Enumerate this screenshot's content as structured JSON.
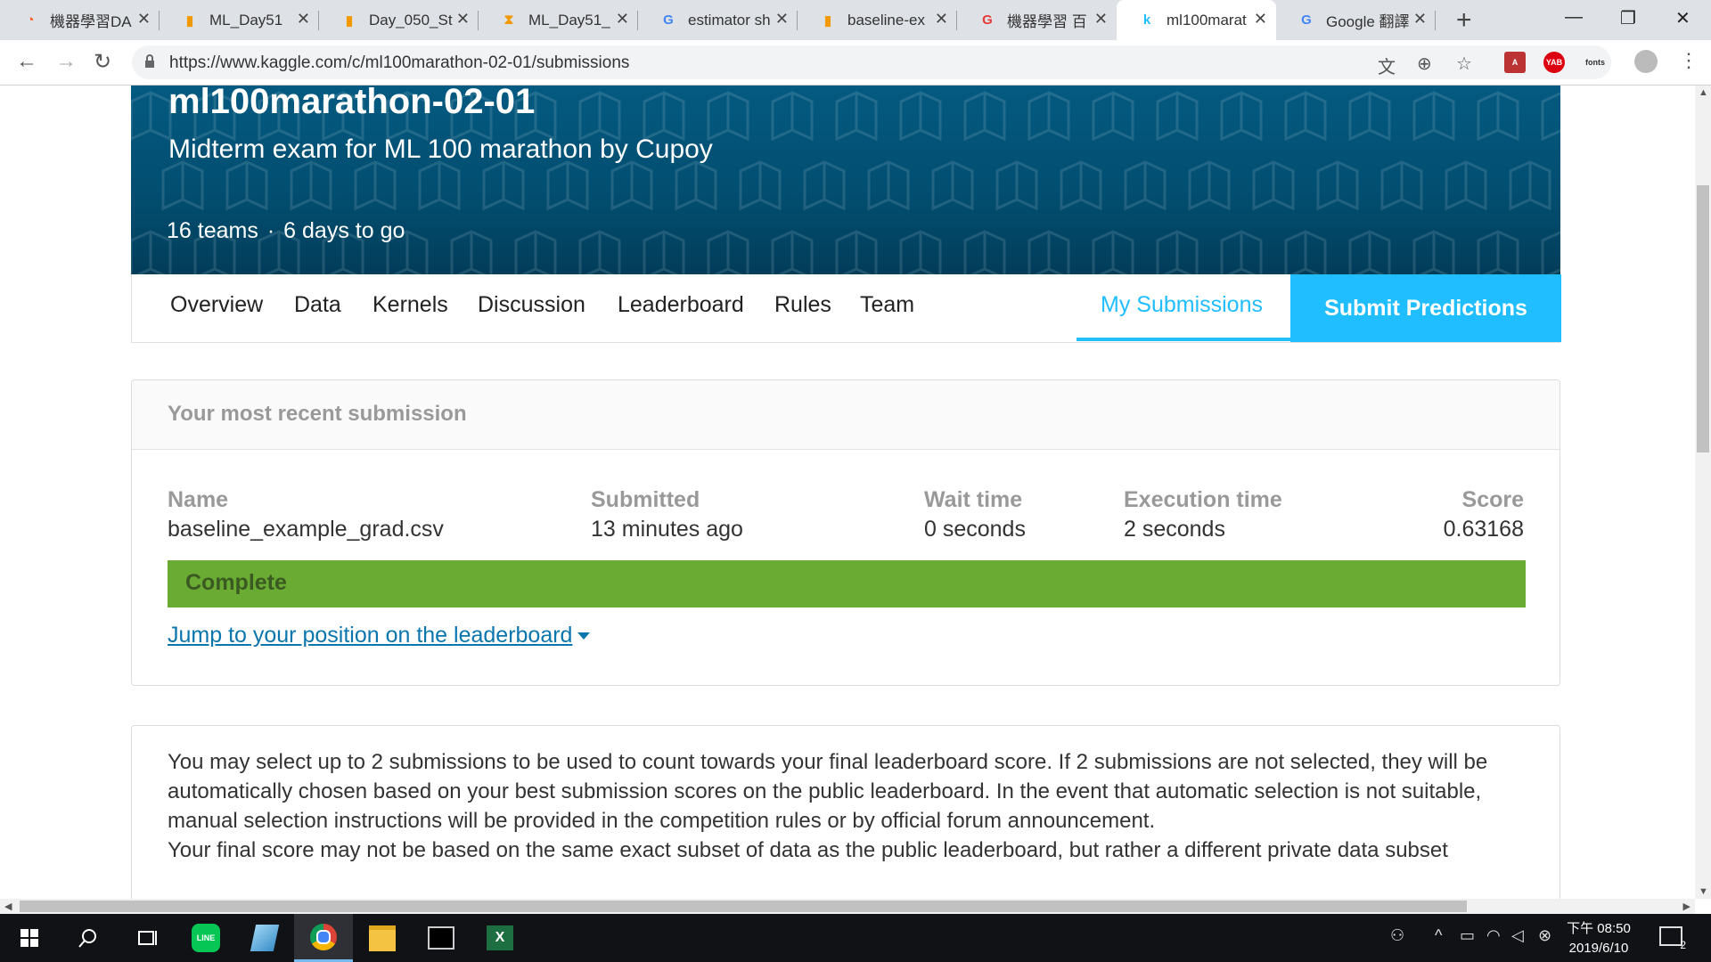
{
  "browser": {
    "tabs": [
      {
        "title": "機器學習DA",
        "icon": "cupoy-icon",
        "color": "#ff5722"
      },
      {
        "title": "ML_Day51",
        "icon": "book-icon",
        "color": "#f29900"
      },
      {
        "title": "Day_050_St",
        "icon": "book-icon",
        "color": "#f29900"
      },
      {
        "title": "ML_Day51_",
        "icon": "hourglass-icon",
        "color": "#f29900"
      },
      {
        "title": "estimator sh",
        "icon": "google-icon",
        "color": "#4285f4"
      },
      {
        "title": "baseline-ex",
        "icon": "book-icon",
        "color": "#f29900"
      },
      {
        "title": "機器學習 百",
        "icon": "cupoy-red-icon",
        "color": "#e53935"
      },
      {
        "title": "ml100marat",
        "icon": "kaggle-icon",
        "color": "#20beff"
      },
      {
        "title": "Google 翻譯",
        "icon": "translate-icon",
        "color": "#4285f4"
      }
    ],
    "url": "https://www.kaggle.com/c/ml100marathon-02-01/submissions",
    "ext_yab": "YAB",
    "ext_fonts": "fonts"
  },
  "competition": {
    "title": "ml100marathon-02-01",
    "subtitle": "Midterm exam for ML 100 marathon by Cupoy",
    "teams": "16 teams",
    "separator": "·",
    "deadline": "6 days to go",
    "tabs": [
      "Overview",
      "Data",
      "Kernels",
      "Discussion",
      "Leaderboard",
      "Rules",
      "Team"
    ],
    "my_submissions": "My Submissions",
    "submit_predictions": "Submit Predictions"
  },
  "recent": {
    "heading": "Your most recent submission",
    "name_label": "Name",
    "name_value": "baseline_example_grad.csv",
    "submitted_label": "Submitted",
    "submitted_value": "13 minutes ago",
    "wait_label": "Wait time",
    "wait_value": "0 seconds",
    "exec_label": "Execution time",
    "exec_value": "2 seconds",
    "score_label": "Score",
    "score_value": "0.63168",
    "status": "Complete",
    "status_color": "#6aac33",
    "jump_link": "Jump to your position on the leaderboard"
  },
  "info": {
    "para1": "You may select up to 2 submissions to be used to count towards your final leaderboard score. If 2 submissions are not selected, they will be automatically chosen based on your best submission scores on the public leaderboard. In the event that automatic selection is not suitable, manual selection instructions will be provided in the competition rules or by official forum announcement.",
    "para2": "Your final score may not be based on the same exact subset of data as the public leaderboard, but rather a different private data subset"
  },
  "taskbar": {
    "clock_line1": "下午 08:50",
    "clock_line2": "2019/6/10",
    "notification_count": "2"
  }
}
